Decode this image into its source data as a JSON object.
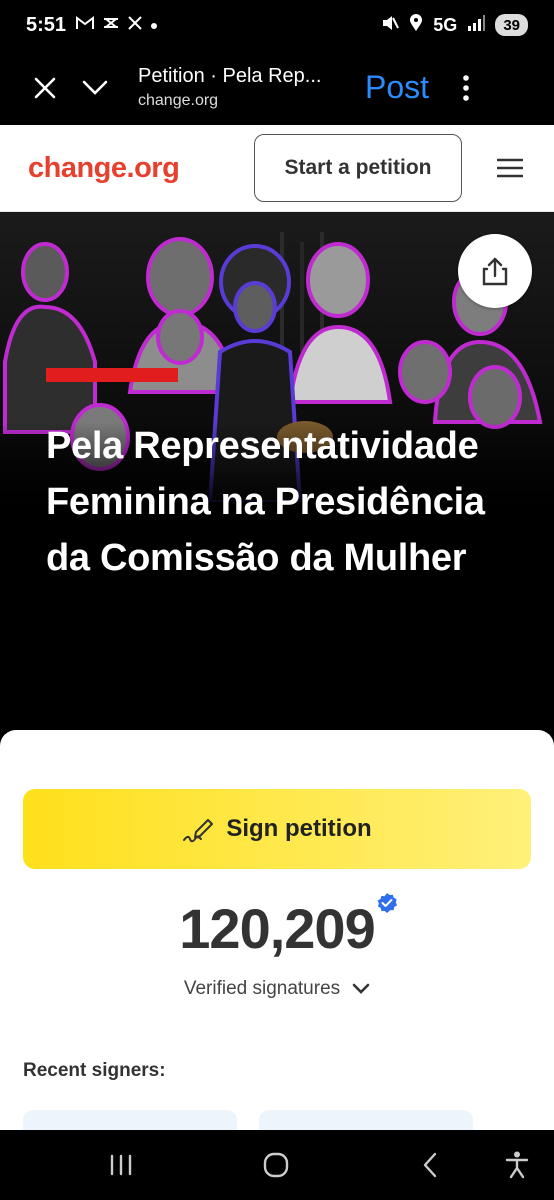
{
  "status_bar": {
    "time": "5:51",
    "left_icons": [
      "gmail-icon",
      "tidal-icon",
      "x-icon",
      "dot-icon"
    ],
    "network": "5G",
    "battery": "39"
  },
  "browser": {
    "title": "Petition · Pela Rep...",
    "domain": "change.org",
    "post_label": "Post"
  },
  "site_header": {
    "logo": "change.org",
    "start_label": "Start a petition"
  },
  "hero": {
    "title": "Pela Representatividade Feminina na Presidência da Comissão da Mulher"
  },
  "petition": {
    "sign_label": "Sign petition",
    "signature_count": "120,209",
    "signatures_label": "Verified signatures",
    "recent_label": "Recent signers:"
  },
  "colors": {
    "brand": "#e8402e",
    "sign_button": "#ffe01b",
    "post_link": "#2b8cff",
    "verified": "#2f6fed"
  }
}
